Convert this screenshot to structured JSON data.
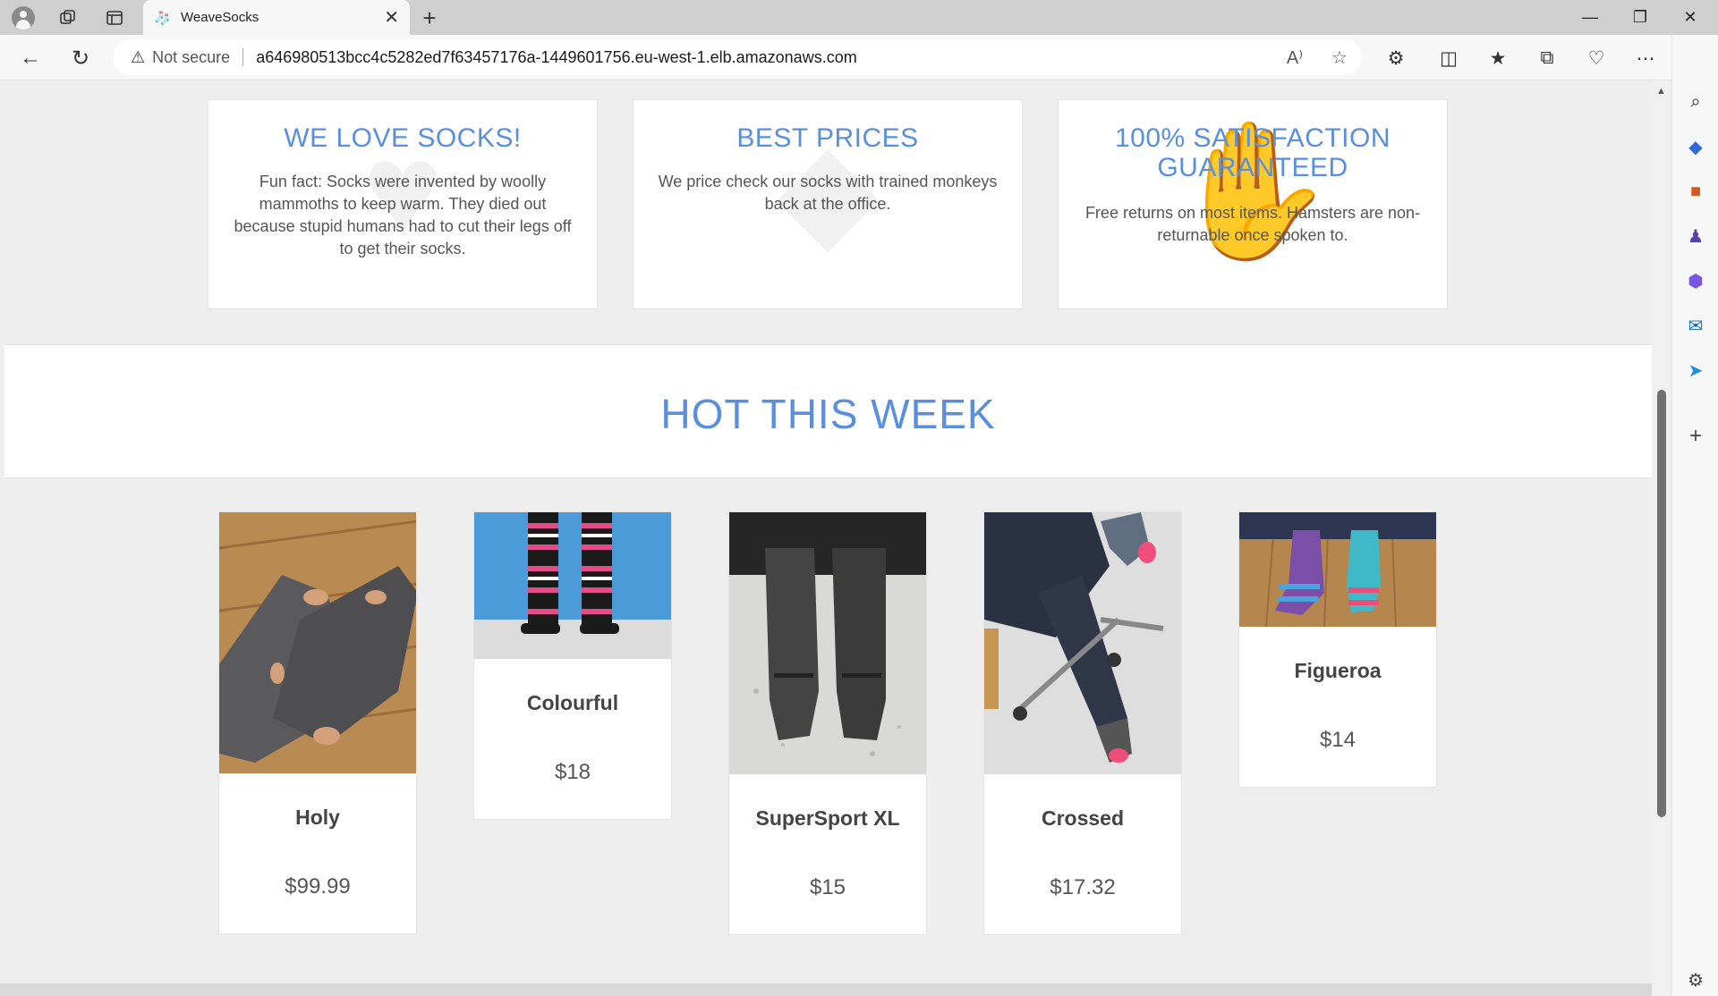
{
  "browser": {
    "tab_title": "WeaveSocks",
    "security_label": "Not secure",
    "url": "a646980513bcc4c5282ed7f63457176a-1449601756.eu-west-1.elb.amazonaws.com"
  },
  "features": [
    {
      "title": "WE LOVE SOCKS!",
      "text": "Fun fact: Socks were invented by woolly mammoths to keep warm. They died out because stupid humans had to cut their legs off to get their socks."
    },
    {
      "title": "BEST PRICES",
      "text": "We price check our socks with trained monkeys back at the office."
    },
    {
      "title": "100% SATISFACTION GUARANTEED",
      "text": "Free returns on most items. Hamsters are non-returnable once spoken to."
    }
  ],
  "hot": {
    "title": "HOT THIS WEEK",
    "products": [
      {
        "name": "Holy",
        "price": "$99.99"
      },
      {
        "name": "Colourful",
        "price": "$18"
      },
      {
        "name": "SuperSport XL",
        "price": "$15"
      },
      {
        "name": "Crossed",
        "price": "$17.32"
      },
      {
        "name": "Figueroa",
        "price": "$14"
      }
    ]
  },
  "icons": {
    "tab_favicon": "socks-icon",
    "back": "back-arrow-icon",
    "refresh": "refresh-icon",
    "warning": "warning-icon"
  }
}
